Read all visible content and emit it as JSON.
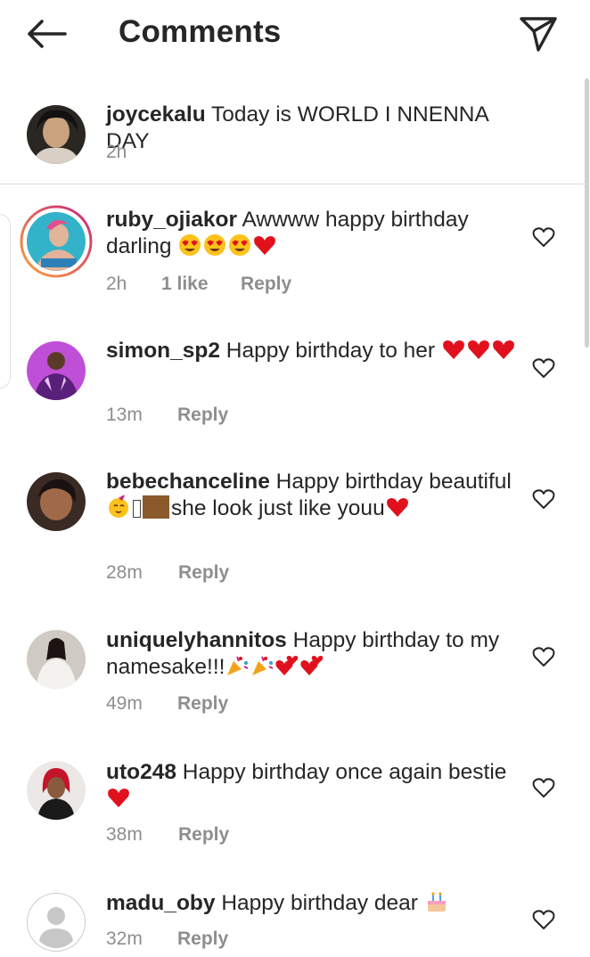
{
  "header": {
    "title": "Comments",
    "back_icon": "arrow-left-icon",
    "direct_icon": "paper-plane-icon"
  },
  "caption": {
    "username": "joycekalu",
    "text": " Today is WORLD I NNENNA DAY",
    "time": "2h"
  },
  "comments": [
    {
      "username": "ruby_ojiakor",
      "text": " Awwww happy birthday darling ",
      "time": "2h",
      "likes": "1 like",
      "reply": "Reply"
    },
    {
      "username": "simon_sp2",
      "text": " Happy birthday to her ",
      "time": "13m",
      "reply": "Reply"
    },
    {
      "username": "bebechanceline",
      "text": " Happy birthday beautiful ",
      "text2": "she look just like youu",
      "time": "28m",
      "reply": "Reply"
    },
    {
      "username": "uniquelyhannitos",
      "text": " Happy birthday to my namesake!!!",
      "time": "49m",
      "reply": "Reply"
    },
    {
      "username": "uto248",
      "text": " Happy birthday once again bestie",
      "time": "38m",
      "reply": "Reply"
    },
    {
      "username": "madu_oby",
      "text": " Happy birthday dear ",
      "time": "32m",
      "reply": "Reply"
    }
  ],
  "colors": {
    "text": "#262626",
    "meta": "#8e8e8e",
    "heart_red": "#e0111d",
    "divider": "#dbdbdb",
    "story_ring_start": "#f9a23b",
    "story_ring_end": "#c8277f"
  }
}
